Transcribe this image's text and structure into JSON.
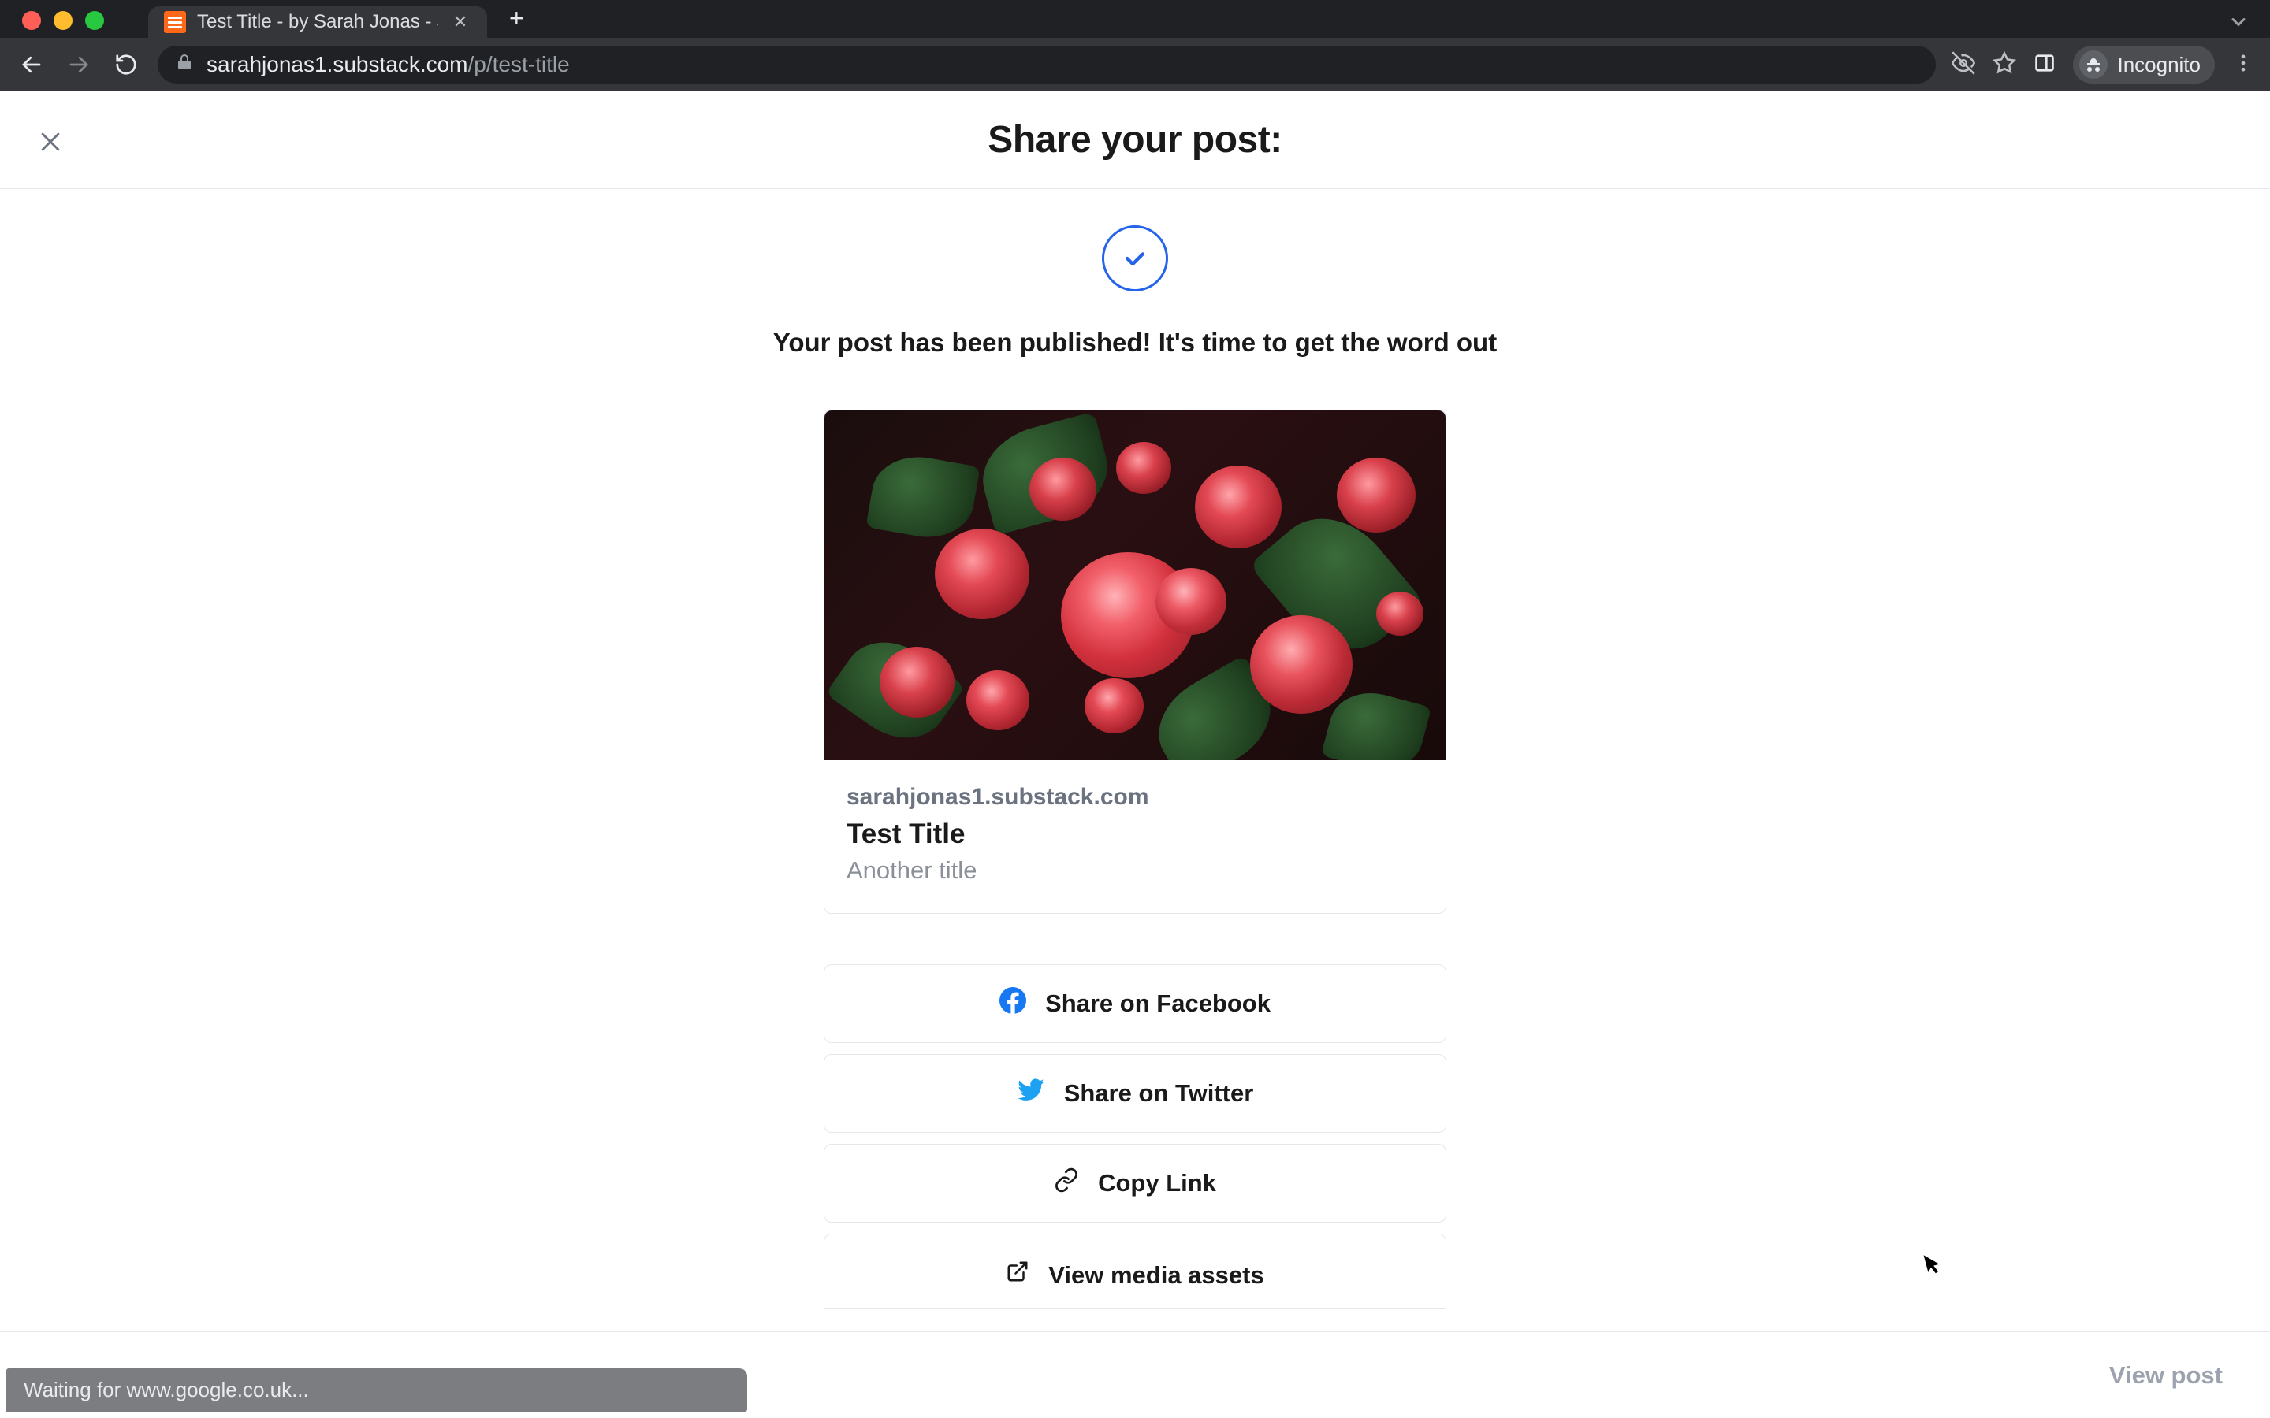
{
  "browser": {
    "tab_title": "Test Title - by Sarah Jonas - S",
    "url_host": "sarahjonas1.substack.com",
    "url_path": "/p/test-title",
    "incognito_label": "Incognito",
    "status_text": "Waiting for www.google.co.uk..."
  },
  "page": {
    "header_title": "Share your post:",
    "published_message": "Your post has been published! It's time to get the word out",
    "card": {
      "domain": "sarahjonas1.substack.com",
      "title": "Test Title",
      "subtitle": "Another title"
    },
    "actions": {
      "facebook": "Share on Facebook",
      "twitter": "Share on Twitter",
      "copy": "Copy Link",
      "assets": "View media assets"
    },
    "view_post": "View post"
  },
  "colors": {
    "accent_blue": "#2563eb",
    "facebook": "#1877F2",
    "twitter": "#1DA1F2"
  }
}
